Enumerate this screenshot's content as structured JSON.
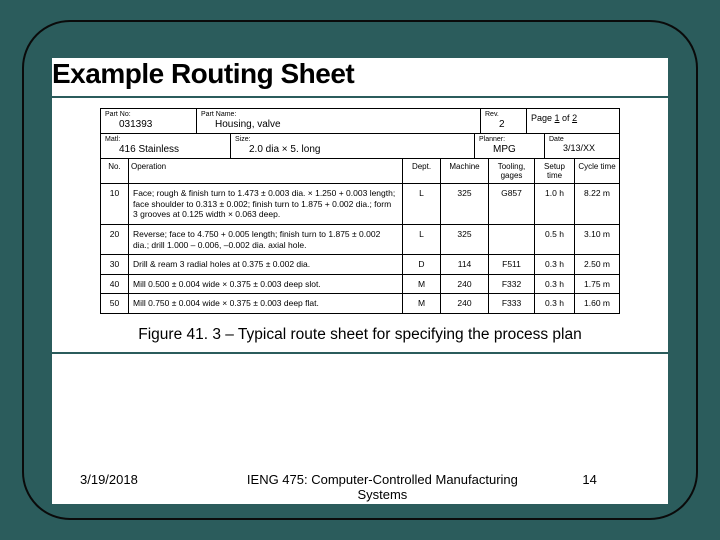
{
  "slide": {
    "title": "Example Routing Sheet",
    "caption": "Figure 41. 3 – Typical route sheet for specifying the process plan"
  },
  "footer": {
    "date": "3/19/2018",
    "course": "IENG 475: Computer-Controlled Manufacturing Systems",
    "page": "14"
  },
  "sheet": {
    "top": {
      "part_no_label": "Part No:",
      "part_no": "031393",
      "part_name_label": "Part Name:",
      "part_name": "Housing, valve",
      "rev_label": "Rev.",
      "rev": "2",
      "page_text_a": "Page ",
      "page_num": "1",
      "page_text_b": " of ",
      "page_total": "2"
    },
    "info": {
      "matl_label": "Matl:",
      "matl": "416 Stainless",
      "size_label": "Size:",
      "size": "2.0 dia × 5. long",
      "planner_label": "Planner:",
      "planner": "MPG",
      "date_label": "Date",
      "date": "3/13/XX"
    },
    "headers": {
      "no": "No.",
      "operation": "Operation",
      "dept": "Dept.",
      "machine": "Machine",
      "tooling": "Tooling, gages",
      "setup": "Setup time",
      "cycle": "Cycle time"
    },
    "ops": [
      {
        "no": "10",
        "desc": "Face; rough & finish turn to 1.473 ± 0.003 dia. × 1.250 + 0.003 length; face shoulder to 0.313 ± 0.002; finish turn to 1.875 + 0.002 dia.; form 3 grooves at 0.125 width × 0.063 deep.",
        "dept": "L",
        "machine": "325",
        "tooling": "G857",
        "setup": "1.0 h",
        "cycle": "8.22 m"
      },
      {
        "no": "20",
        "desc": "Reverse; face to 4.750 + 0.005 length; finish turn to 1.875 ± 0.002 dia.; drill 1.000 – 0.006, –0.002 dia. axial hole.",
        "dept": "L",
        "machine": "325",
        "tooling": "",
        "setup": "0.5 h",
        "cycle": "3.10 m"
      },
      {
        "no": "30",
        "desc": "Drill & ream 3 radial holes at 0.375 ± 0.002 dia.",
        "dept": "D",
        "machine": "114",
        "tooling": "F511",
        "setup": "0.3 h",
        "cycle": "2.50 m"
      },
      {
        "no": "40",
        "desc": "Mill 0.500 ± 0.004 wide × 0.375 ± 0.003 deep slot.",
        "dept": "M",
        "machine": "240",
        "tooling": "F332",
        "setup": "0.3 h",
        "cycle": "1.75 m"
      },
      {
        "no": "50",
        "desc": "Mill 0.750 ± 0.004 wide × 0.375 ± 0.003 deep flat.",
        "dept": "M",
        "machine": "240",
        "tooling": "F333",
        "setup": "0.3 h",
        "cycle": "1.60 m"
      }
    ]
  }
}
